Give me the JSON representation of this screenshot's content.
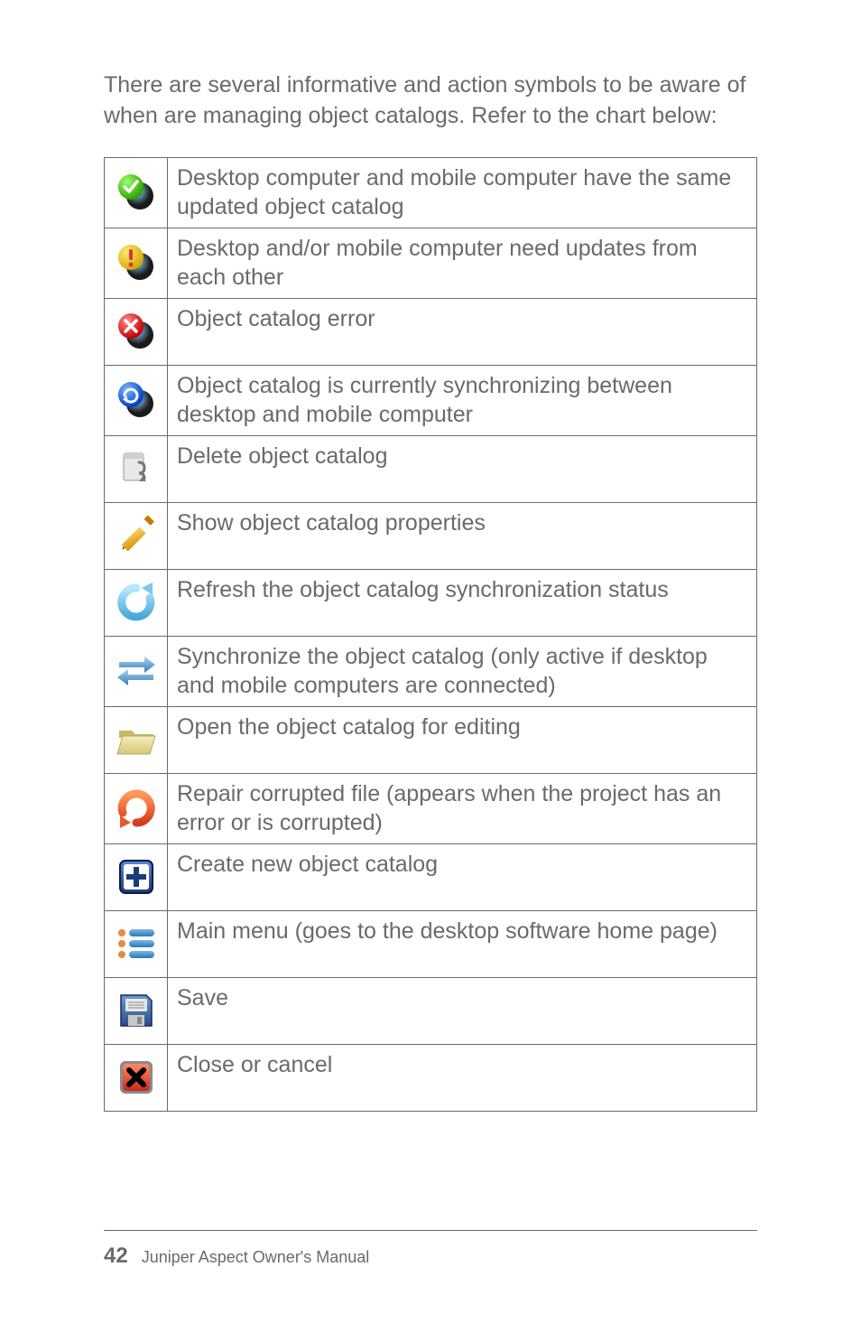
{
  "intro": "There are several informative and action symbols to be aware of when are managing object catalogs. Refer to the chart below:",
  "rows": [
    {
      "icon": "sync-ok",
      "text": "Desktop computer and mobile computer have the same updated object catalog"
    },
    {
      "icon": "sync-warn",
      "text": "Desktop and/or mobile computer need updates from each other"
    },
    {
      "icon": "sync-error",
      "text": "Object catalog error"
    },
    {
      "icon": "sync-busy",
      "text": "Object catalog is currently synchronizing between desktop and mobile computer"
    },
    {
      "icon": "delete",
      "text": "Delete object catalog"
    },
    {
      "icon": "pencil",
      "text": "Show object catalog properties"
    },
    {
      "icon": "refresh",
      "text": "Refresh the object catalog synchronization status"
    },
    {
      "icon": "two-arrows",
      "text": "Synchronize the object catalog (only active if desktop and mobile computers are connected)"
    },
    {
      "icon": "folder",
      "text": "Open the object catalog for editing"
    },
    {
      "icon": "undo-red",
      "text": "Repair corrupted file (appears when the project has an error or is corrupted)"
    },
    {
      "icon": "plus-box",
      "text": "Create new object catalog"
    },
    {
      "icon": "menu-list",
      "text": "Main menu (goes to the desktop software home page)"
    },
    {
      "icon": "save-floppy",
      "text": "Save"
    },
    {
      "icon": "close-box",
      "text": "Close or cancel"
    }
  ],
  "footer": {
    "page_number": "42",
    "title": "Juniper Aspect Owner's Manual"
  }
}
